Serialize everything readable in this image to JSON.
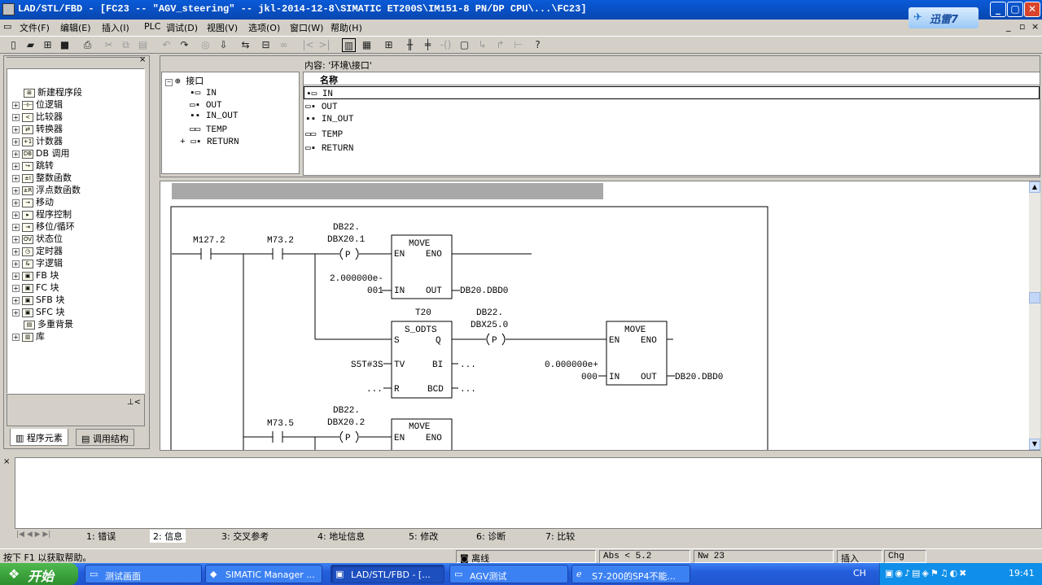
{
  "window": {
    "title": "LAD/STL/FBD  - [FC23 -- \"AGV_steering\" -- jkl-2014-12-8\\SIMATIC ET200S\\IM151-8 PN/DP CPU\\...\\FC23]",
    "xunlei_label": "迅雷7"
  },
  "menu": [
    "文件(F)",
    "编辑(E)",
    "插入(I)",
    "PLC",
    "调试(D)",
    "视图(V)",
    "选项(O)",
    "窗口(W)",
    "帮助(H)"
  ],
  "left_tree": {
    "items": [
      "新建程序段",
      "位逻辑",
      "比较器",
      "转换器",
      "计数器",
      "DB 调用",
      "跳转",
      "整数函数",
      "浮点数函数",
      "移动",
      "程序控制",
      "移位/循环",
      "状态位",
      "定时器",
      "字逻辑",
      "FB 块",
      "FC 块",
      "SFB 块",
      "SFC 块",
      "多重背景",
      "库"
    ],
    "tabs": [
      "程序元素",
      "调用结构"
    ]
  },
  "interface": {
    "root": "接口",
    "items": [
      "IN",
      "OUT",
      "IN_OUT",
      "TEMP",
      "RETURN"
    ],
    "content_label": "内容: '环境\\接口'",
    "column_name": "名称",
    "rows": [
      "IN",
      "OUT",
      "IN_OUT",
      "TEMP",
      "RETURN"
    ]
  },
  "ladder": {
    "net1": {
      "c1": "M127.2",
      "c2": "M73.2",
      "coil_addr_1": "DB22.",
      "coil_addr_2": "DBX20.1",
      "coil_sym": "P",
      "move_title": "MOVE",
      "en": "EN",
      "eno": "ENO",
      "in": "IN",
      "out": "OUT",
      "in_val_1": "2.000000e-",
      "in_val_2": "001",
      "out_val": "DB20.DBD0",
      "timer": "T20",
      "timer_title": "S_ODTS",
      "s": "S",
      "q": "Q",
      "tv": "TV",
      "bi": "BI",
      "r": "R",
      "bcd": "BCD",
      "tv_val": "S5T#3S",
      "dots": "...",
      "coil2_addr_1": "DB22.",
      "coil2_addr_2": "DBX25.0",
      "move2_title": "MOVE",
      "in2_val_1": "0.000000e+",
      "in2_val_2": "000",
      "out2_val": "DB20.DBD0"
    },
    "net2": {
      "c1": "M73.5",
      "coil_addr_1": "DB22.",
      "coil_addr_2": "DBX20.2",
      "move_title": "MOVE",
      "en": "EN",
      "eno": "ENO"
    }
  },
  "bottom_tabs": [
    "1: 错误",
    "2: 信息",
    "3: 交叉参考",
    "4: 地址信息",
    "5: 修改",
    "6: 诊断",
    "7: 比较"
  ],
  "status": {
    "help": "按下 F1 以获取帮助。",
    "mode": "离线",
    "abs": "Abs < 5.2",
    "nw": "Nw 23",
    "insert": "插入",
    "chg": "Chg"
  },
  "taskbar": {
    "start": "开始",
    "buttons": [
      "测试画面",
      "SIMATIC Manager ...",
      "LAD/STL/FBD  - [...",
      "AGV测试",
      "S7-200的SP4不能..."
    ],
    "lang": "CH",
    "clock": "19:41"
  }
}
